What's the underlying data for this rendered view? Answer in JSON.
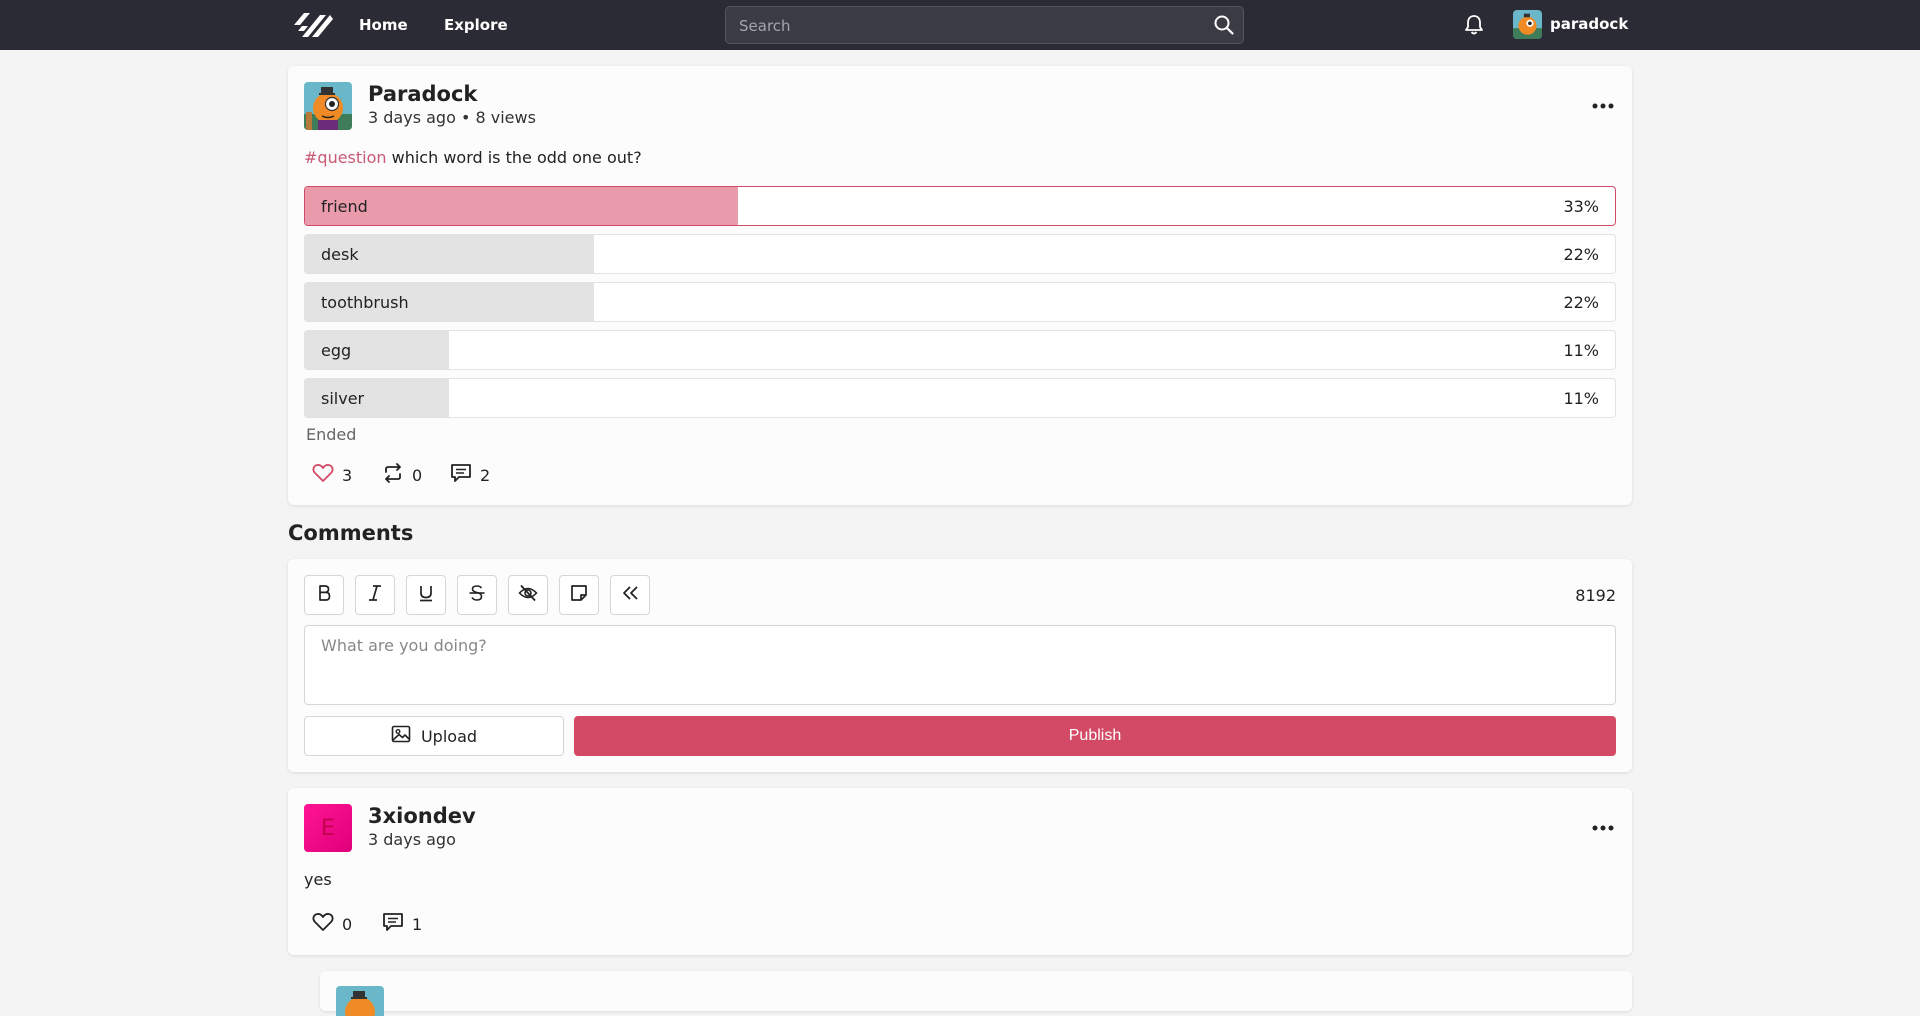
{
  "nav": {
    "home": "Home",
    "explore": "Explore",
    "search_placeholder": "Search",
    "username": "paradock"
  },
  "post": {
    "author": "Paradock",
    "meta": "3 days ago • 8 views",
    "hashtag": "#question",
    "text": " which word is the odd one out?",
    "poll": [
      {
        "label": "friend",
        "percent": "33%",
        "value": 0.33,
        "selected": true
      },
      {
        "label": "desk",
        "percent": "22%",
        "value": 0.22,
        "selected": false
      },
      {
        "label": "toothbrush",
        "percent": "22%",
        "value": 0.22,
        "selected": false
      },
      {
        "label": "egg",
        "percent": "11%",
        "value": 0.11,
        "selected": false
      },
      {
        "label": "silver",
        "percent": "11%",
        "value": 0.11,
        "selected": false
      }
    ],
    "status": "Ended",
    "likes": "3",
    "reposts": "0",
    "comments": "2"
  },
  "comments_section": {
    "title": "Comments",
    "char_limit": "8192",
    "placeholder": "What are you doing?",
    "upload_label": "Upload",
    "publish_label": "Publish",
    "toolbar": [
      "bold",
      "italic",
      "underline",
      "strikethrough",
      "spoiler",
      "sticky-note",
      "quote"
    ]
  },
  "comment": {
    "author": "3xiondev",
    "avatar_letter": "E",
    "meta": "3 days ago",
    "text": "yes",
    "likes": "0",
    "replies": "1"
  },
  "colors": {
    "accent": "#d24a66",
    "hashtag": "#c85a75",
    "topbar": "#2b2b35",
    "poll_selected_fill": "#e99aab",
    "poll_fill": "#e3e3e3"
  }
}
